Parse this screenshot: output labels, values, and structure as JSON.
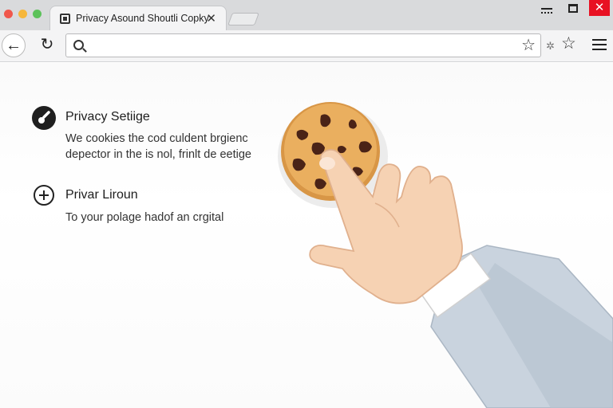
{
  "tab": {
    "title": "Privacy Asound Shoutli   Copky",
    "close_glyph": "✕"
  },
  "window": {
    "close_glyph": "✕"
  },
  "toolbar": {
    "back_glyph": "←",
    "reload_glyph": "↻",
    "url_value": "",
    "url_placeholder": "",
    "star_glyph": "☆",
    "ext_glyph": "✲"
  },
  "content": {
    "section1": {
      "title": "Privacy Setiige",
      "line1": "We cookies the cod culdent brgienc",
      "line2": "depector in the is nol, frinlt de eetige"
    },
    "section2": {
      "title": "Privar Liroun",
      "line1": "To your polage hadof an crgital"
    }
  },
  "colors": {
    "traffic_red": "#f0574c",
    "traffic_yellow": "#f6b73c",
    "traffic_green": "#5cc25a",
    "cookie": "#e7a95a",
    "chip": "#5a2a1a",
    "close_red": "#e81123"
  },
  "icons": [
    "search-icon",
    "star-icon",
    "menu-icon",
    "back-icon",
    "reload-icon",
    "key-icon",
    "plus-circle-icon",
    "cookie-icon",
    "hand-illustration"
  ]
}
